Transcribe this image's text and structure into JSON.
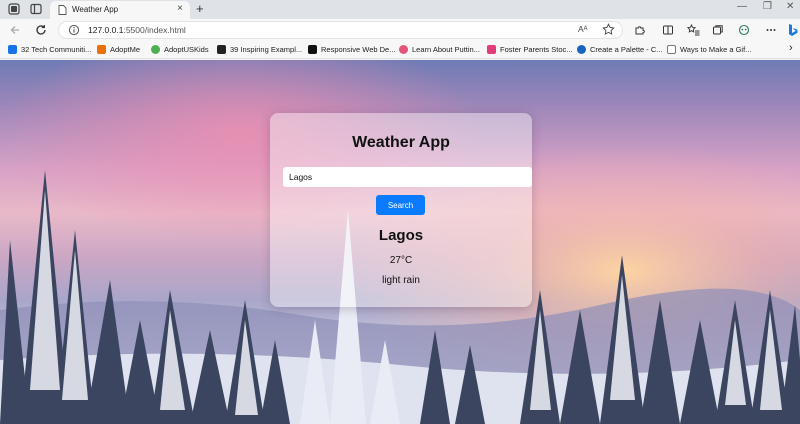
{
  "browser": {
    "tab_title": "Weather App",
    "new_tab_glyph": "+",
    "close_tab_glyph": "×",
    "url_host": "127.0.0.1",
    "url_rest": ":5500/index.html",
    "read_aloud_label": "Aᴬ",
    "window_controls": [
      "—",
      "❐",
      "✕"
    ],
    "bookmarks": [
      {
        "label": "32 Tech Communiti...",
        "icon": "tech-icon",
        "color": "#1a73e8"
      },
      {
        "label": "AdoptMe",
        "icon": "adoptme-icon",
        "color": "#e8710a"
      },
      {
        "label": "AdoptUSKids",
        "icon": "adoptuskids-icon",
        "color": "#4caf50"
      },
      {
        "label": "39 Inspiring Exampl...",
        "icon": "seo-icon",
        "color": "#222222"
      },
      {
        "label": "Responsive Web De...",
        "icon": "responsive-icon",
        "color": "#111111"
      },
      {
        "label": "Learn About Puttin...",
        "icon": "heart-icon",
        "color": "#e2547a"
      },
      {
        "label": "Foster Parents Stoc...",
        "icon": "foster-icon",
        "color": "#e23b7a"
      },
      {
        "label": "Create a Palette - C...",
        "icon": "palette-icon",
        "color": "#1565c0"
      },
      {
        "label": "Ways to Make a Gif...",
        "icon": "page-icon",
        "color": "#777777"
      }
    ],
    "more_bookmarks_glyph": "›"
  },
  "app": {
    "title": "Weather App",
    "search_value": "Lagos",
    "search_button_label": "Search",
    "city": "Lagos",
    "temperature": "27°C",
    "description": "light rain",
    "button_color": "#0a7bff"
  }
}
